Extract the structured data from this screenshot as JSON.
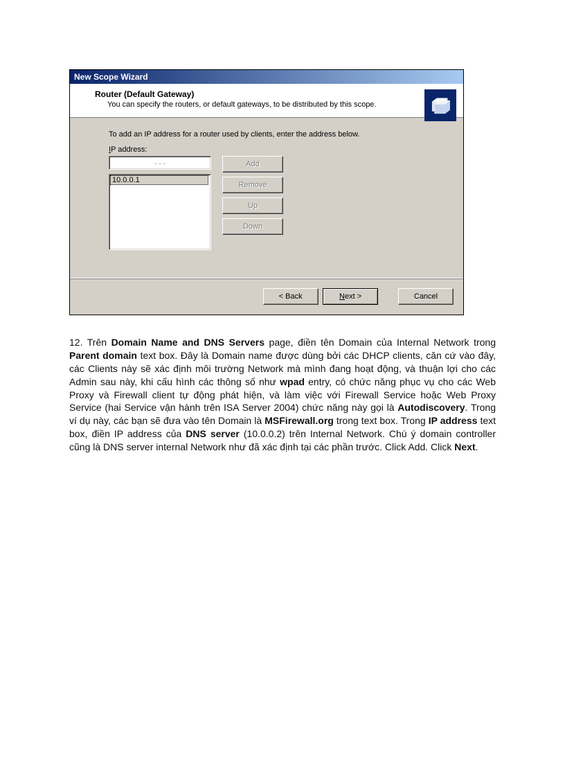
{
  "dialog": {
    "title": "New Scope Wizard",
    "header_title": "Router (Default Gateway)",
    "header_sub": "You can specify the routers, or default gateways, to be distributed by this scope.",
    "body_text": "To add an IP address for a router used by clients, enter the address below.",
    "ip_label": "IP address:",
    "ip_input_value": ".      .      .",
    "ip_list": [
      "10.0.0.1"
    ],
    "buttons": {
      "add": "Add",
      "remove": "Remove",
      "up": "Up",
      "down": "Down"
    },
    "footer": {
      "back": "< Back",
      "next": "Next >",
      "cancel": "Cancel"
    }
  },
  "article": {
    "num": "12.",
    "t1": "Trên ",
    "b1": "Domain Name and DNS Servers",
    "t2": " page, điền tên Domain của Internal Network trong ",
    "b2": "Parent domain",
    "t3": " text box. Đây là Domain name được dùng bởi các DHCP clients, căn cứ vào đây, các Clients này sẽ xác định môi trường Network mà mình đang hoạt động, và thuận lợi cho các Admin sau này, khi cấu hình các thông số như ",
    "b3": "wpad",
    "t4": " entry, có chức năng phục vụ cho các Web Proxy và Firewall client tự động phát hiện, và làm việc với Firewall Service hoặc Web Proxy Service (hai Service vận hành trên ISA Server 2004) chức năng này gọi là ",
    "b4": "Autodiscovery",
    "t5": ". Trong ví dụ này, các bạn sẽ đưa vào tên Domain là ",
    "b5": "MSFirewall.org",
    "t6": " trong text box. Trong ",
    "b6": "IP address",
    "t7": " text box, điền IP address của ",
    "b7": "DNS server",
    "t8": " (10.0.0.2) trên Internal Network. Chú ý domain controller cũng là DNS server internal Network như đã xác định tại các phần trước. Click Add. Click ",
    "b8": "Next",
    "t9": "."
  }
}
